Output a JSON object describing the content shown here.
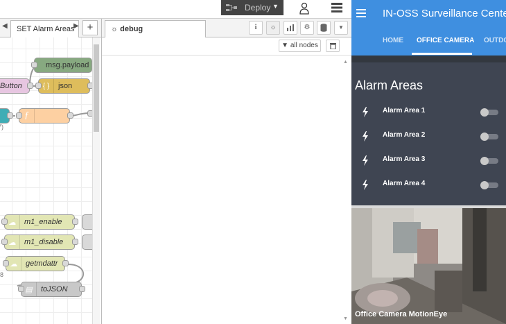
{
  "editor": {
    "deploy_label": "Deploy",
    "tab_label": "SET Alarm Areas",
    "add_tab": "+",
    "nodes": {
      "msg_payload": "msg.payload",
      "button_partial": "Button",
      "json": "json",
      "label_partial_7": "7)",
      "m1_enable": "m1_enable",
      "m1_disable": "m1_disable",
      "getmdattr": "getmdattr",
      "label_partial_8": "8",
      "tojson": "toJSON"
    }
  },
  "sidebar": {
    "debug_tab": "debug",
    "filter_label": "all nodes",
    "buttons": [
      "info",
      "debug",
      "dashboard",
      "config",
      "context",
      "more"
    ]
  },
  "dashboard": {
    "title": "IN-OSS Surveillance Center",
    "tabs": [
      {
        "label": "HOME"
      },
      {
        "label": "OFFICE CAMERA"
      },
      {
        "label": "OUTDO"
      }
    ],
    "group_title": "Alarm Areas",
    "switches": [
      {
        "label": "Alarm Area 1",
        "state": "off"
      },
      {
        "label": "Alarm Area 2",
        "state": "off"
      },
      {
        "label": "Alarm Area 3",
        "state": "off"
      },
      {
        "label": "Alarm Area 4",
        "state": "off"
      }
    ],
    "camera_caption": "Office Camera MotionEye",
    "colors": {
      "header": "#3f8fe0",
      "background": "#3f4552"
    }
  }
}
